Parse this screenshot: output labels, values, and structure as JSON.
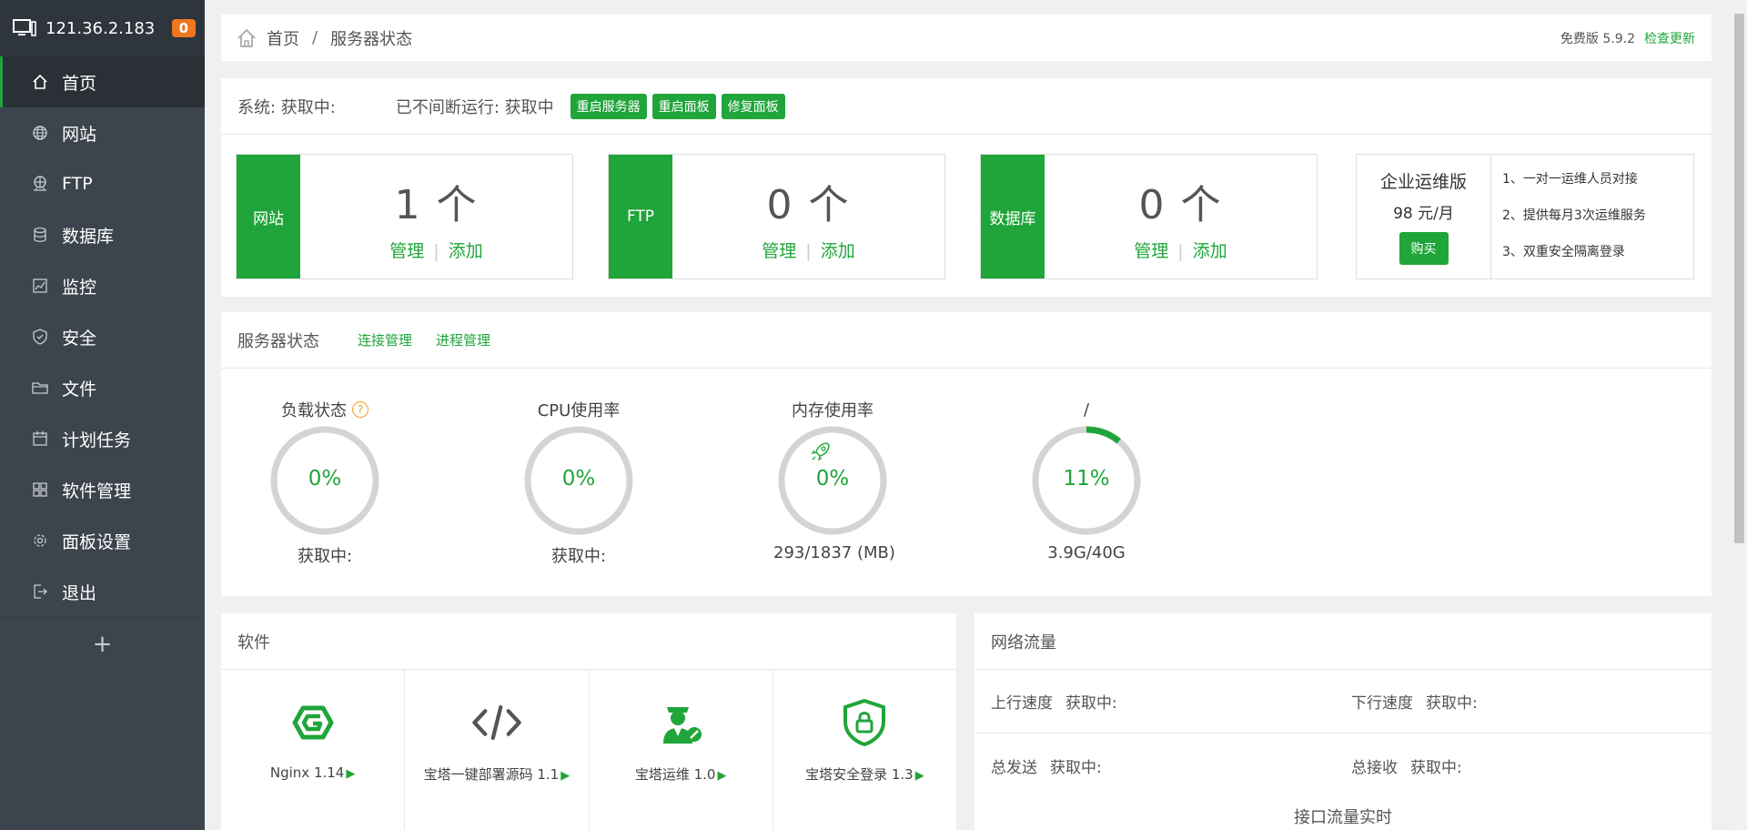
{
  "sidebar": {
    "server_ip": "121.36.2.183",
    "badge": "0",
    "items": [
      {
        "label": "首页",
        "icon": "home-icon",
        "active": true
      },
      {
        "label": "网站",
        "icon": "globe-icon"
      },
      {
        "label": "FTP",
        "icon": "ftp-icon"
      },
      {
        "label": "数据库",
        "icon": "database-icon"
      },
      {
        "label": "监控",
        "icon": "monitor-icon"
      },
      {
        "label": "安全",
        "icon": "shield-icon"
      },
      {
        "label": "文件",
        "icon": "folder-icon"
      },
      {
        "label": "计划任务",
        "icon": "calendar-icon"
      },
      {
        "label": "软件管理",
        "icon": "apps-icon"
      },
      {
        "label": "面板设置",
        "icon": "gear-icon"
      },
      {
        "label": "退出",
        "icon": "logout-icon"
      }
    ],
    "add_label": "+"
  },
  "header": {
    "breadcrumb": [
      "首页",
      "服务器状态"
    ],
    "separator": "/",
    "version": "免费版 5.9.2",
    "update_label": "检查更新"
  },
  "system": {
    "system_text": "系统: 获取中:",
    "uptime_text": "已不间断运行: 获取中",
    "buttons": [
      "重启服务器",
      "重启面板",
      "修复面板"
    ]
  },
  "stats": [
    {
      "label": "网站",
      "count": "1 个",
      "manage": "管理",
      "add": "添加"
    },
    {
      "label": "FTP",
      "count": "0 个",
      "manage": "管理",
      "add": "添加"
    },
    {
      "label": "数据库",
      "count": "0 个",
      "manage": "管理",
      "add": "添加"
    }
  ],
  "enterprise": {
    "title": "企业运维版",
    "price": "98 元/月",
    "buy_label": "购买",
    "features": [
      "1、一对一运维人员对接",
      "2、提供每月3次运维服务",
      "3、双重安全隔离登录"
    ]
  },
  "server_status": {
    "title": "服务器状态",
    "links": [
      "连接管理",
      "进程管理"
    ],
    "gauges": [
      {
        "title": "负载状态",
        "value": "0%",
        "percent": 0,
        "sub": "获取中:",
        "help": "?"
      },
      {
        "title": "CPU使用率",
        "value": "0%",
        "percent": 0,
        "sub": "获取中:"
      },
      {
        "title": "内存使用率",
        "value": "0%",
        "percent": 0,
        "sub": "293/1837 (MB)"
      },
      {
        "title": "/",
        "value": "11%",
        "percent": 11,
        "sub": "3.9G/40G"
      }
    ]
  },
  "software": {
    "title": "软件",
    "items": [
      {
        "name": "Nginx 1.14",
        "icon": "nginx-icon"
      },
      {
        "name": "宝塔一键部署源码 1.1",
        "icon": "code-icon"
      },
      {
        "name": "宝塔运维 1.0",
        "icon": "ops-engineer-icon"
      },
      {
        "name": "宝塔安全登录 1.3",
        "icon": "secure-login-icon"
      }
    ],
    "arrow": "▶"
  },
  "network": {
    "title": "网络流量",
    "upload_label": "上行速度",
    "upload_value": "获取中:",
    "download_label": "下行速度",
    "download_value": "获取中:",
    "sent_label": "总发送",
    "sent_value": "获取中:",
    "recv_label": "总接收",
    "recv_value": "获取中:",
    "chart_title": "接口流量实时"
  },
  "colors": {
    "accent": "#20a53a",
    "sidebar_bg": "#3c444d",
    "badge": "#f0761f"
  }
}
